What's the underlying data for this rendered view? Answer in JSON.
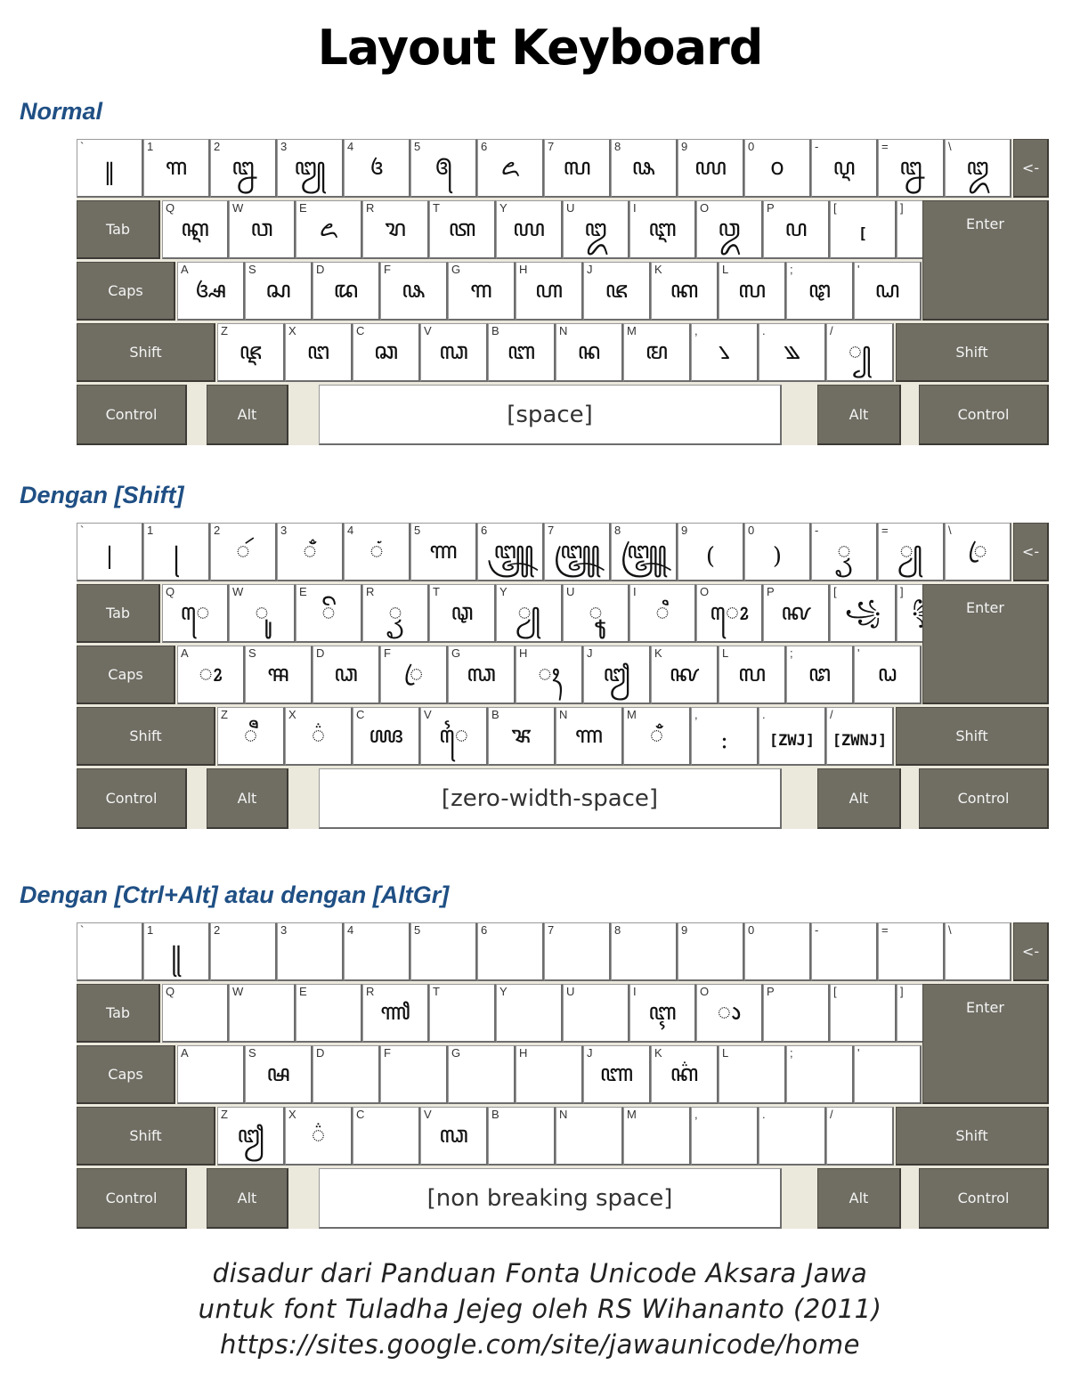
{
  "title": "Layout Keyboard",
  "sections": [
    {
      "heading": "Normal",
      "space_label": "[space]",
      "rows": [
        [
          {
            "label": "`",
            "glyph": "‖"
          },
          {
            "label": "1",
            "glyph": "꧑"
          },
          {
            "label": "2",
            "glyph": "꧒"
          },
          {
            "label": "3",
            "glyph": "꧓"
          },
          {
            "label": "4",
            "glyph": "꧔"
          },
          {
            "label": "5",
            "glyph": "꧕"
          },
          {
            "label": "6",
            "glyph": "꧖"
          },
          {
            "label": "7",
            "glyph": "꧗"
          },
          {
            "label": "8",
            "glyph": "꧘"
          },
          {
            "label": "9",
            "glyph": "꧙"
          },
          {
            "label": "0",
            "glyph": "꧐"
          },
          {
            "label": "-",
            "glyph": "ꦉ"
          },
          {
            "label": "=",
            "glyph": "ꦊ"
          },
          {
            "label": "\\",
            "glyph": "ꦈ"
          }
        ],
        [
          {
            "label": "Q",
            "glyph": "ꦐ"
          },
          {
            "label": "W",
            "glyph": "ꦮ"
          },
          {
            "label": "E",
            "glyph": "ꦌ"
          },
          {
            "label": "R",
            "glyph": "ꦫ"
          },
          {
            "label": "T",
            "glyph": "ꦠ"
          },
          {
            "label": "Y",
            "glyph": "ꦪ"
          },
          {
            "label": "U",
            "glyph": "ꦈ"
          },
          {
            "label": "I",
            "glyph": "ꦆ"
          },
          {
            "label": "O",
            "glyph": "ꦎ"
          },
          {
            "label": "P",
            "glyph": "ꦥ"
          },
          {
            "label": "[",
            "glyph": "["
          },
          {
            "label": "]",
            "glyph": "]"
          }
        ],
        [
          {
            "label": "A",
            "glyph": "ꦄ"
          },
          {
            "label": "S",
            "glyph": "ꦱ"
          },
          {
            "label": "D",
            "glyph": "ꦢ"
          },
          {
            "label": "F",
            "glyph": "ꦦ"
          },
          {
            "label": "G",
            "glyph": "ꦒ"
          },
          {
            "label": "H",
            "glyph": "ꦲ"
          },
          {
            "label": "J",
            "glyph": "ꦗ"
          },
          {
            "label": "K",
            "glyph": "ꦏ"
          },
          {
            "label": "L",
            "glyph": "ꦭ"
          },
          {
            "label": ";",
            "glyph": "ꦛ"
          },
          {
            "label": "'",
            "glyph": "ꦝ"
          }
        ],
        [
          {
            "label": "Z",
            "glyph": "ꦘ"
          },
          {
            "label": "X",
            "glyph": "ꦔ"
          },
          {
            "label": "C",
            "glyph": "ꦕ"
          },
          {
            "label": "V",
            "glyph": "ꦓ"
          },
          {
            "label": "B",
            "glyph": "ꦧ"
          },
          {
            "label": "N",
            "glyph": "ꦤ"
          },
          {
            "label": "M",
            "glyph": "ꦩ"
          },
          {
            "label": ",",
            "glyph": "꧈"
          },
          {
            "label": ".",
            "glyph": "꧉"
          },
          {
            "label": "/",
            "glyph": "꧀"
          }
        ]
      ]
    },
    {
      "heading": "Dengan [Shift]",
      "space_label": "[zero-width-space]",
      "rows": [
        [
          {
            "label": "`",
            "glyph": "|"
          },
          {
            "label": "1",
            "glyph": "꧊"
          },
          {
            "label": "2",
            "glyph": "ꦂ"
          },
          {
            "label": "3",
            "glyph": "ꦀ"
          },
          {
            "label": "4",
            "glyph": "ꦁ"
          },
          {
            "label": "5",
            "glyph": "ꦟ"
          },
          {
            "label": "6",
            "glyph": "꧃"
          },
          {
            "label": "7",
            "glyph": "꧄"
          },
          {
            "label": "8",
            "glyph": "꧅"
          },
          {
            "label": "9",
            "glyph": "("
          },
          {
            "label": "0",
            "glyph": ")"
          },
          {
            "label": "-",
            "glyph": "ꦽ"
          },
          {
            "label": "=",
            "glyph": "ꦾ"
          },
          {
            "label": "\\",
            "glyph": "ꦿ"
          }
        ],
        [
          {
            "label": "Q",
            "glyph": "ꦺ"
          },
          {
            "label": "W",
            "glyph": "ꦸ"
          },
          {
            "label": "E",
            "glyph": "ꦼ"
          },
          {
            "label": "R",
            "glyph": "ꦽ"
          },
          {
            "label": "T",
            "glyph": "ꦡ"
          },
          {
            "label": "Y",
            "glyph": "ꦾ"
          },
          {
            "label": "U",
            "glyph": "ꦹ"
          },
          {
            "label": "I",
            "glyph": "ꦶ"
          },
          {
            "label": "O",
            "glyph": "ꦺꦴ"
          },
          {
            "label": "P",
            "glyph": "ꦑ"
          },
          {
            "label": "[",
            "glyph": "꧁"
          },
          {
            "label": "]",
            "glyph": "꧂"
          }
        ],
        [
          {
            "label": "A",
            "glyph": "ꦴ"
          },
          {
            "label": "S",
            "glyph": "ꦯ"
          },
          {
            "label": "D",
            "glyph": "ꦣ"
          },
          {
            "label": "F",
            "glyph": "ꦿ"
          },
          {
            "label": "G",
            "glyph": "ꦓ"
          },
          {
            "label": "H",
            "glyph": "ꦃ"
          },
          {
            "label": "J",
            "glyph": "ꦙ"
          },
          {
            "label": "K",
            "glyph": "ꦑ"
          },
          {
            "label": "L",
            "glyph": "ꦭ"
          },
          {
            "label": ";",
            "glyph": "ꦜ"
          },
          {
            "label": "'",
            "glyph": "ꦞ"
          }
        ],
        [
          {
            "label": "Z",
            "glyph": "ꦷ"
          },
          {
            "label": "X",
            "glyph": "꦳"
          },
          {
            "label": "C",
            "glyph": "ꦖ"
          },
          {
            "label": "V",
            "glyph": "ꦻ"
          },
          {
            "label": "B",
            "glyph": "ꦨ"
          },
          {
            "label": "N",
            "glyph": "ꦟ"
          },
          {
            "label": "M",
            "glyph": "ꦀ"
          },
          {
            "label": ",",
            "glyph": ":"
          },
          {
            "label": ".",
            "glyph": "[ZWJ]"
          },
          {
            "label": "/",
            "glyph": "[ZWNJ]"
          }
        ]
      ]
    },
    {
      "heading": "Dengan [Ctrl+Alt] atau dengan [AltGr]",
      "space_label": "[non breaking space]",
      "rows": [
        [
          {
            "label": "`",
            "glyph": ""
          },
          {
            "label": "1",
            "glyph": "꧋"
          },
          {
            "label": "2",
            "glyph": ""
          },
          {
            "label": "3",
            "glyph": ""
          },
          {
            "label": "4",
            "glyph": ""
          },
          {
            "label": "5",
            "glyph": ""
          },
          {
            "label": "6",
            "glyph": ""
          },
          {
            "label": "7",
            "glyph": ""
          },
          {
            "label": "8",
            "glyph": ""
          },
          {
            "label": "9",
            "glyph": ""
          },
          {
            "label": "0",
            "glyph": ""
          },
          {
            "label": "-",
            "glyph": ""
          },
          {
            "label": "=",
            "glyph": ""
          },
          {
            "label": "\\",
            "glyph": ""
          }
        ],
        [
          {
            "label": "Q",
            "glyph": ""
          },
          {
            "label": "W",
            "glyph": ""
          },
          {
            "label": "E",
            "glyph": ""
          },
          {
            "label": "R",
            "glyph": "ꦬ"
          },
          {
            "label": "T",
            "glyph": ""
          },
          {
            "label": "Y",
            "glyph": ""
          },
          {
            "label": "U",
            "glyph": ""
          },
          {
            "label": "I",
            "glyph": "ꦇ"
          },
          {
            "label": "O",
            "glyph": "ꦵ"
          },
          {
            "label": "P",
            "glyph": ""
          },
          {
            "label": "[",
            "glyph": ""
          },
          {
            "label": "]",
            "glyph": ""
          }
        ],
        [
          {
            "label": "A",
            "glyph": ""
          },
          {
            "label": "S",
            "glyph": "ꦰ"
          },
          {
            "label": "D",
            "glyph": ""
          },
          {
            "label": "F",
            "glyph": ""
          },
          {
            "label": "G",
            "glyph": ""
          },
          {
            "label": "H",
            "glyph": ""
          },
          {
            "label": "J",
            "glyph": "ꦚ"
          },
          {
            "label": "K",
            "glyph": "ꦏ꦳"
          },
          {
            "label": "L",
            "glyph": ""
          },
          {
            "label": ";",
            "glyph": ""
          },
          {
            "label": "'",
            "glyph": ""
          }
        ],
        [
          {
            "label": "Z",
            "glyph": "ꦙ"
          },
          {
            "label": "X",
            "glyph": "꦳"
          },
          {
            "label": "C",
            "glyph": ""
          },
          {
            "label": "V",
            "glyph": "ꦓ"
          },
          {
            "label": "B",
            "glyph": ""
          },
          {
            "label": "N",
            "glyph": ""
          },
          {
            "label": "M",
            "glyph": ""
          },
          {
            "label": ",",
            "glyph": ""
          },
          {
            "label": ".",
            "glyph": ""
          },
          {
            "label": "/",
            "glyph": ""
          }
        ]
      ]
    }
  ],
  "modifiers": {
    "backspace": "<-",
    "tab": "Tab",
    "caps": "Caps",
    "enter": "Enter",
    "shift": "Shift",
    "control": "Control",
    "alt": "Alt"
  },
  "footer": [
    "disadur dari Panduan Fonta Unicode Aksara Jawa",
    "untuk font Tuladha Jejeg oleh RS Wihananto (2011)",
    "https://sites.google.com/site/jawaunicode/home"
  ]
}
